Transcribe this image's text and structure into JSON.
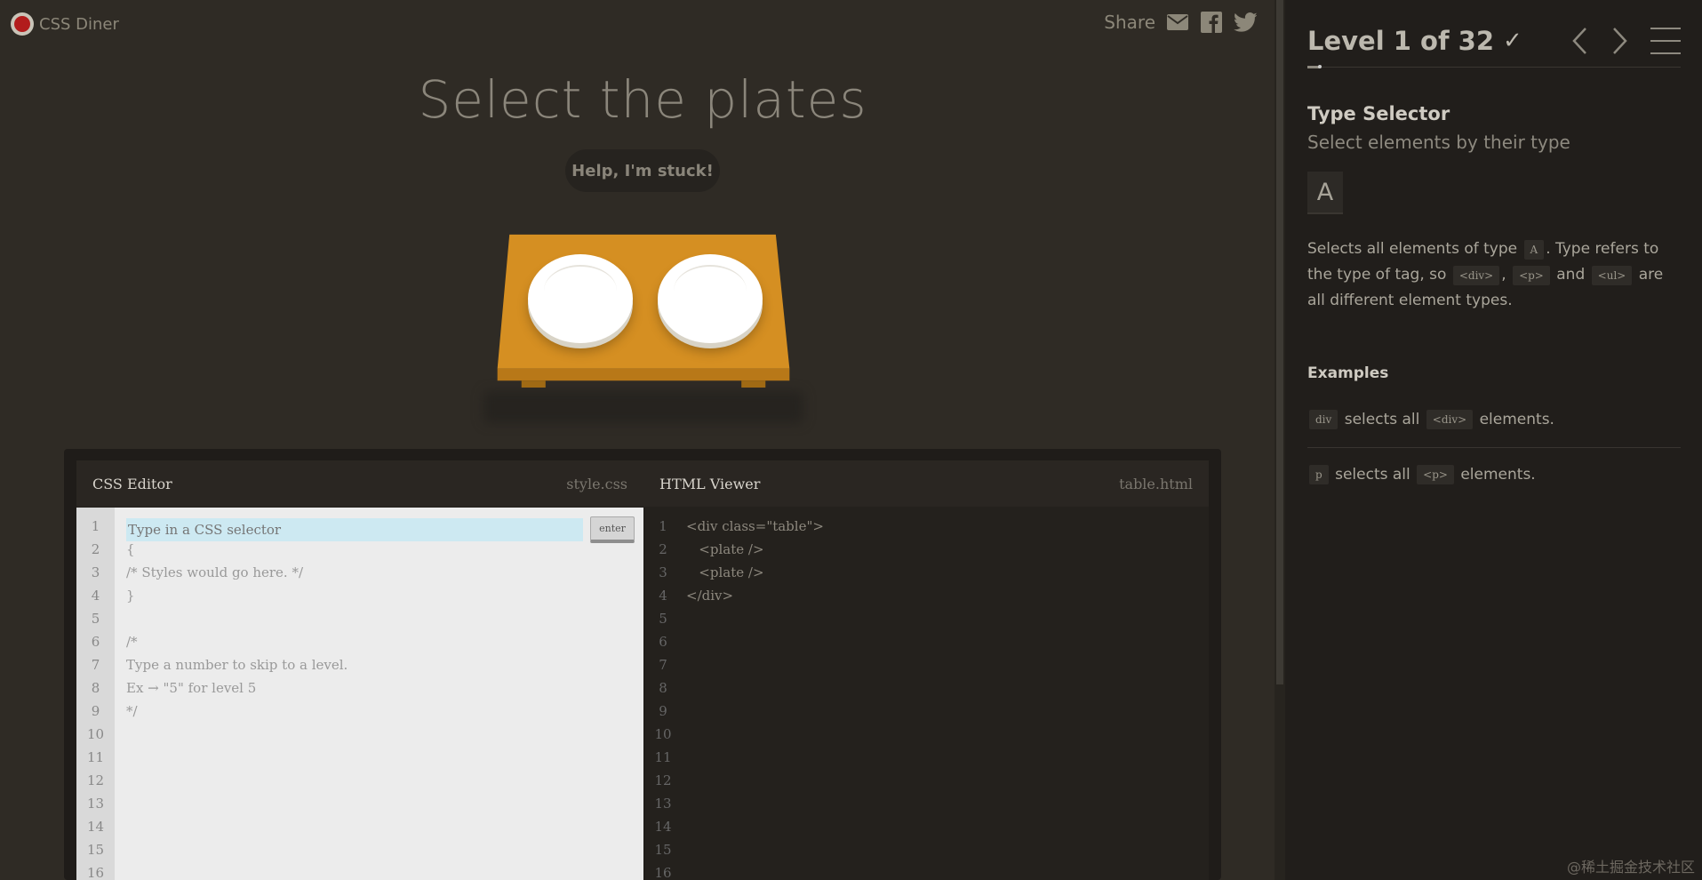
{
  "app": {
    "name": "CSS Diner",
    "brand_red": "#b21c1c"
  },
  "share": {
    "label": "Share",
    "icons": [
      "mail-icon",
      "facebook-icon",
      "twitter-icon"
    ]
  },
  "level": {
    "title": "Select the plates",
    "help_label": "Help, I'm stuck!"
  },
  "editor": {
    "css_title": "CSS Editor",
    "css_file": "style.css",
    "html_title": "HTML Viewer",
    "html_file": "table.html",
    "input_placeholder": "Type in a CSS selector",
    "enter_label": "enter",
    "css_lines": [
      "",
      "{",
      "/* Styles would go here. */",
      "}",
      "",
      "/*",
      "Type a number to skip to a level.",
      "Ex → \"5\" for level 5",
      "*/",
      "",
      "",
      "",
      "",
      "",
      "",
      ""
    ],
    "html_lines": [
      "<div class=\"table\">",
      "   <plate />",
      "   <plate />",
      "</div>",
      "",
      "",
      "",
      "",
      "",
      "",
      "",
      "",
      "",
      "",
      "",
      ""
    ],
    "line_numbers": [
      "1",
      "2",
      "3",
      "4",
      "5",
      "6",
      "7",
      "8",
      "9",
      "10",
      "11",
      "12",
      "13",
      "14",
      "15",
      "16"
    ]
  },
  "sidebar": {
    "level_text": "Level 1 of 32",
    "progress_fraction": 0.03125,
    "selector_name": "Type Selector",
    "selector_desc": "Select elements by their type",
    "syntax": "A",
    "body": {
      "t1": "Selects all elements of type",
      "c1": "A",
      "t2": ". Type refers to the type of tag, so",
      "c2": "<div>",
      "t3": ",",
      "c3": "<p>",
      "t4": "and",
      "c4": "<ul>",
      "t5": "are all different element types."
    },
    "examples_title": "Examples",
    "examples": [
      {
        "chip": "div",
        "t1": "selects all",
        "chip2": "<div>",
        "t2": "elements."
      },
      {
        "chip": "p",
        "t1": "selects all",
        "chip2": "<p>",
        "t2": "elements."
      }
    ]
  },
  "watermark": "@稀土掘金技术社区"
}
